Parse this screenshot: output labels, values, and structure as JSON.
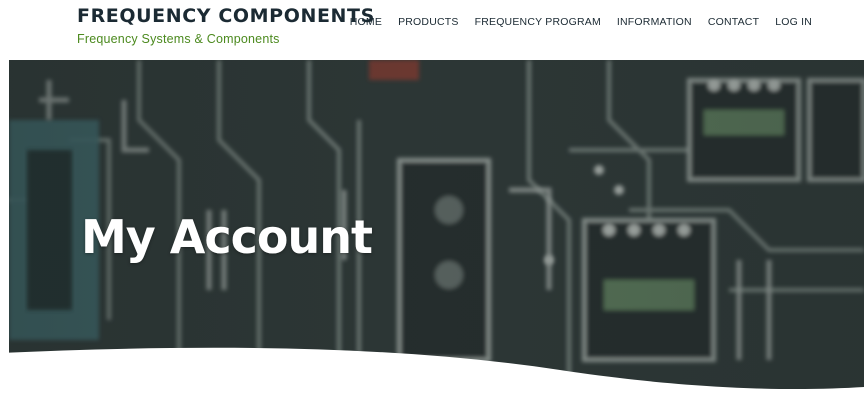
{
  "brand": {
    "title": "FREQUENCY COMPONENTS",
    "subtitle": "Frequency Systems & Components"
  },
  "nav": {
    "items": [
      {
        "label": "HOME"
      },
      {
        "label": "PRODUCTS"
      },
      {
        "label": "FREQUENCY PROGRAM"
      },
      {
        "label": "INFORMATION"
      },
      {
        "label": "CONTACT"
      },
      {
        "label": "LOG IN"
      }
    ]
  },
  "hero": {
    "title": "My Account",
    "background_icon": "circuit-board-image"
  },
  "colors": {
    "brand_dark": "#1b2a33",
    "brand_green": "#4c8a1f",
    "hero_overlay": "#2b3433"
  }
}
